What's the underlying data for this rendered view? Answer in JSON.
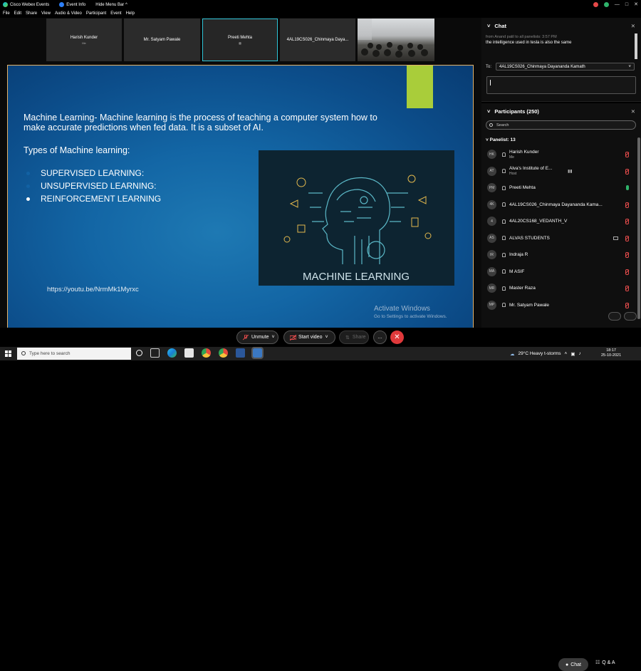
{
  "titlebar": {
    "app_name": "Cisco Webex Events",
    "event_info": "Event Info",
    "hide_menu_bar": "Hide Menu Bar ^"
  },
  "menubar": [
    "File",
    "Edit",
    "Share",
    "View",
    "Audio & Video",
    "Participant",
    "Event",
    "Help"
  ],
  "thumbnails": [
    {
      "name": "Harish Kunder",
      "sub": "Me"
    },
    {
      "name": "Mr. Satyam Pawale",
      "sub": ""
    },
    {
      "name": "Preeti Mehta",
      "sub": ""
    },
    {
      "name": "4AL19CS026_Chinmaya Daya...",
      "sub": ""
    }
  ],
  "slide": {
    "paragraph": "Machine Learning- Machine learning is the process of teaching a computer system how to make accurate predictions when fed data. It is a subset of AI.",
    "types_heading": "Types of Machine learning:",
    "list": [
      "SUPERVISED LEARNING:",
      "UNSUPERVISED LEARNING:",
      "REINFORCEMENT LEARNING"
    ],
    "link": "https://youtu.be/NrmMk1Myrxc",
    "image_caption": "MACHINE LEARNING",
    "activate_title": "Activate Windows",
    "activate_sub": "Go to Settings to activate Windows."
  },
  "controls": {
    "unmute": "Unmute",
    "start_video": "Start video",
    "share": "Share",
    "more": "…",
    "leave": "✕",
    "chat": "Chat",
    "qa": "Q & A"
  },
  "chat": {
    "title": "Chat",
    "from_line": "from Anand patil to all panelists:    3:57 PM",
    "message": "the intelligence used in tesla is also the same",
    "to_label": "To:",
    "to_value": "4AL19CS026_Chinmaya Dayananda Kamath"
  },
  "participants": {
    "title": "Participants (250)",
    "search_placeholder": "Search",
    "panelist_label": "Panelist: 13",
    "list": [
      {
        "initials": "HK",
        "name": "Harish Kunder",
        "role": "Me",
        "audio": "muted"
      },
      {
        "initials": "AT",
        "name": "Alva's Institute of E...",
        "role": "Host",
        "audio": "muted"
      },
      {
        "initials": "PM",
        "name": "Preeti Mehta",
        "role": "",
        "audio": "unmuted"
      },
      {
        "initials": "4K",
        "name": "4AL19CS026_Chinmaya Dayananda Kama...",
        "role": "",
        "audio": "muted"
      },
      {
        "initials": "4",
        "name": "4AL20CS168_VEDANTH_V",
        "role": "",
        "audio": "muted"
      },
      {
        "initials": "AS",
        "name": "ALVAS STUDENTS",
        "role": "",
        "audio": "muted"
      },
      {
        "initials": "IR",
        "name": "Indraja R",
        "role": "",
        "audio": "muted"
      },
      {
        "initials": "MA",
        "name": "M ASIF",
        "role": "",
        "audio": "muted"
      },
      {
        "initials": "MR",
        "name": "Master Raza",
        "role": "",
        "audio": "muted"
      },
      {
        "initials": "MP",
        "name": "Mr. Satyam Pawale",
        "role": "",
        "audio": "muted"
      }
    ]
  },
  "taskbar": {
    "search_placeholder": "Type here to search",
    "weather": "29°C  Heavy t-storms",
    "time": "18:17",
    "date": "25-10-2021"
  }
}
